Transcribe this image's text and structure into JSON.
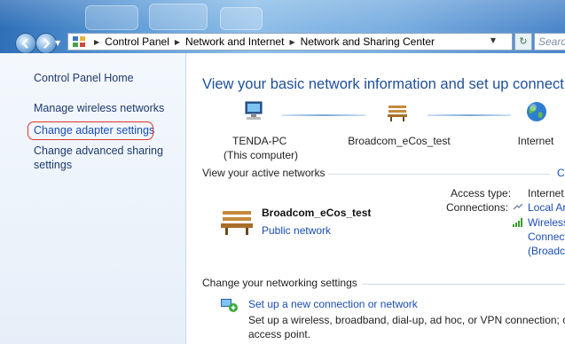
{
  "address_bar": {
    "crumbs": [
      "Control Panel",
      "Network and Internet",
      "Network and Sharing Center"
    ],
    "search_placeholder": "Search Co"
  },
  "sidebar": {
    "home": "Control Panel Home",
    "items": [
      "Manage wireless networks",
      "Change adapter settings",
      "Change advanced sharing",
      "settings"
    ]
  },
  "main": {
    "heading": "View your basic network information and set up connections",
    "map": {
      "computer_name": "TENDA-PC",
      "computer_sub": "(This computer)",
      "network": "Broadcom_eCos_test",
      "internet": "Internet"
    },
    "active_networks": {
      "title": "View your active networks",
      "overflow_link": "C",
      "network_name": "Broadcom_eCos_test",
      "network_type": "Public network",
      "access_type_label": "Access type:",
      "access_type_value": "Internet",
      "connections_label": "Connections:",
      "connection_1": "Local Ar",
      "connection_2": "Wireless",
      "connection_2_line2": "Connect",
      "connection_2_line3": "(Broadc"
    },
    "settings": {
      "title": "Change your networking settings",
      "task_link": "Set up a new connection or network",
      "task_desc_1": "Set up a wireless, broadband, dial-up, ad hoc, or VPN connection; or s",
      "task_desc_2": "access point."
    }
  },
  "colors": {
    "link": "#1a4db3",
    "heading": "#1e4f9c",
    "highlight": "#e2332b"
  }
}
